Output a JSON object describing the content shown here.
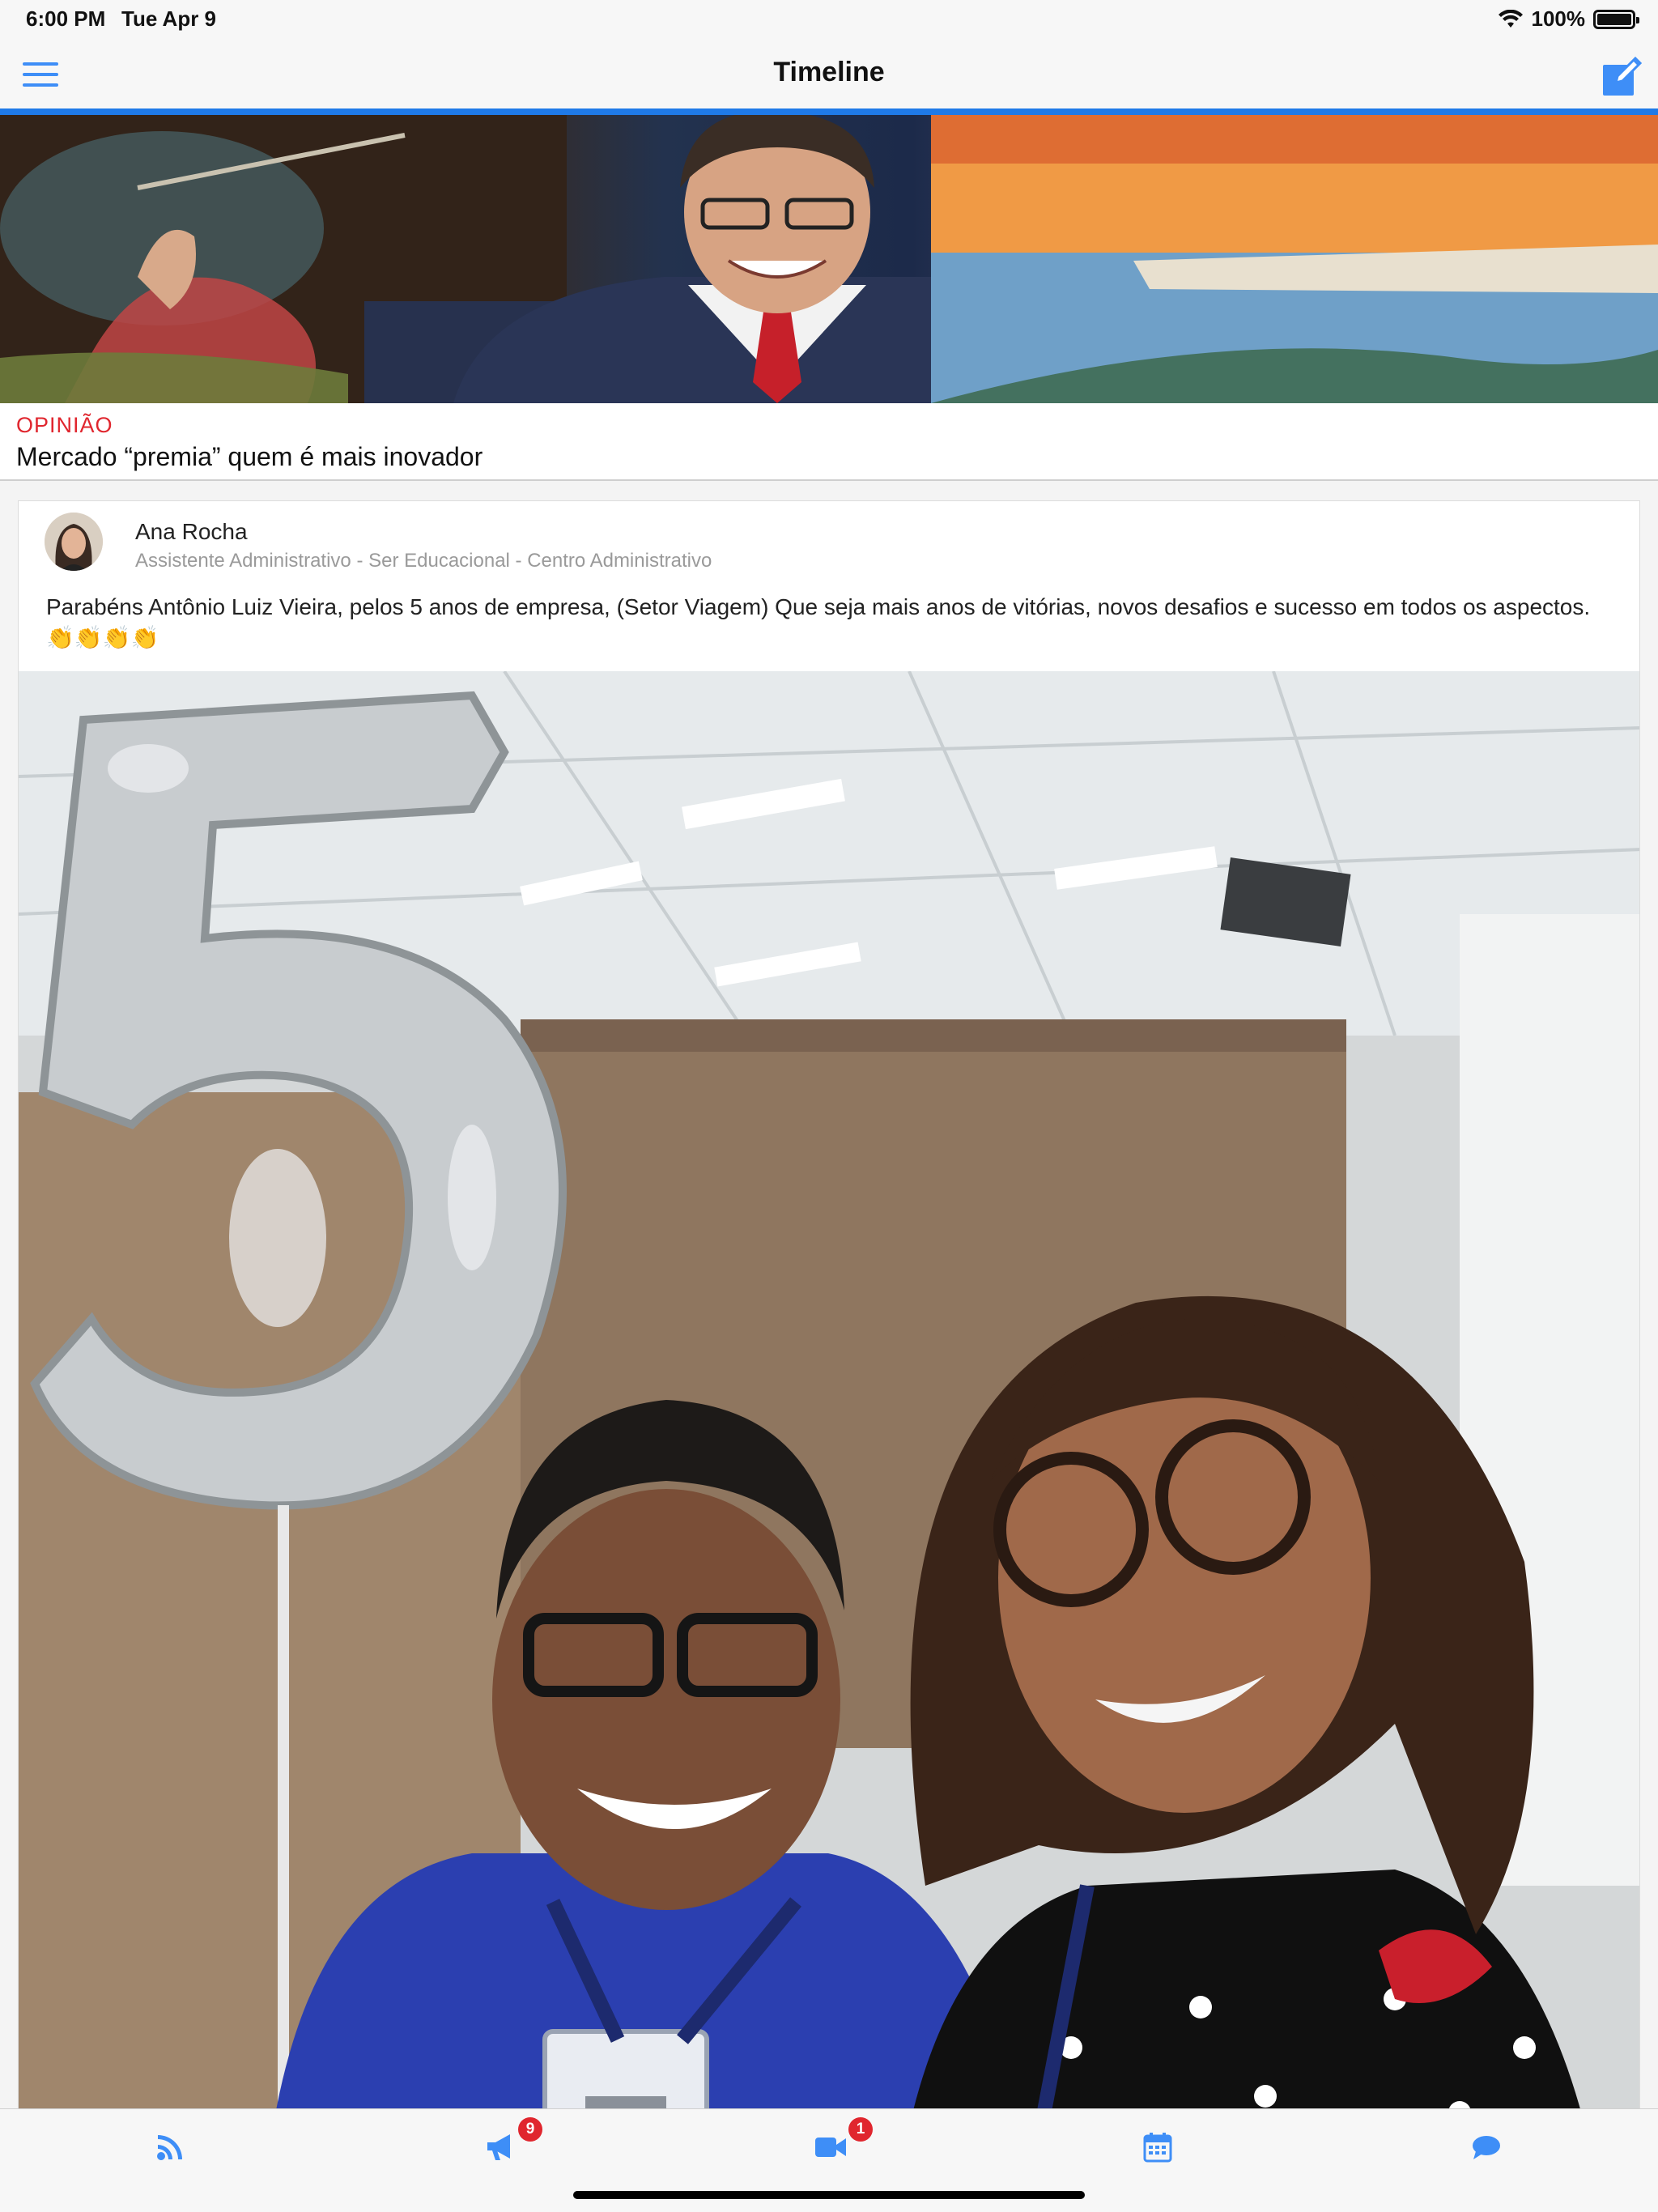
{
  "status_bar": {
    "time": "6:00 PM",
    "date": "Tue Apr 9",
    "battery_percent": "100%",
    "battery_level": 1.0,
    "icons": [
      "wifi-icon",
      "battery-icon"
    ]
  },
  "nav": {
    "title": "Timeline",
    "menu_icon": "hamburger-menu-icon",
    "compose_icon": "compose-icon",
    "accent_color": "#3e8ef7"
  },
  "hero": {
    "category": "OPINIÃO",
    "title": "Mercado “premia” quem é mais inovador",
    "category_color": "#e0262e"
  },
  "post": {
    "author_name": "Ana Rocha",
    "author_role": "Assistente Administrativo - Ser Educacional - Centro Administrativo",
    "text": "Parabéns Antônio Luiz Vieira, pelos 5 anos de empresa, (Setor Viagem) Que seja mais anos de vitórias, novos desafios e sucesso em todos os aspectos. 👏👏👏👏"
  },
  "tab_bar": {
    "tabs": [
      {
        "name": "feed",
        "icon": "rss-feed-icon",
        "badge": ""
      },
      {
        "name": "announcements",
        "icon": "megaphone-icon",
        "badge": "9"
      },
      {
        "name": "videos",
        "icon": "video-camera-icon",
        "badge": "1"
      },
      {
        "name": "calendar",
        "icon": "calendar-icon",
        "badge": ""
      },
      {
        "name": "chat",
        "icon": "chat-bubble-icon",
        "badge": ""
      }
    ],
    "icon_color": "#3e8ef7",
    "badge_color": "#e0262e"
  }
}
